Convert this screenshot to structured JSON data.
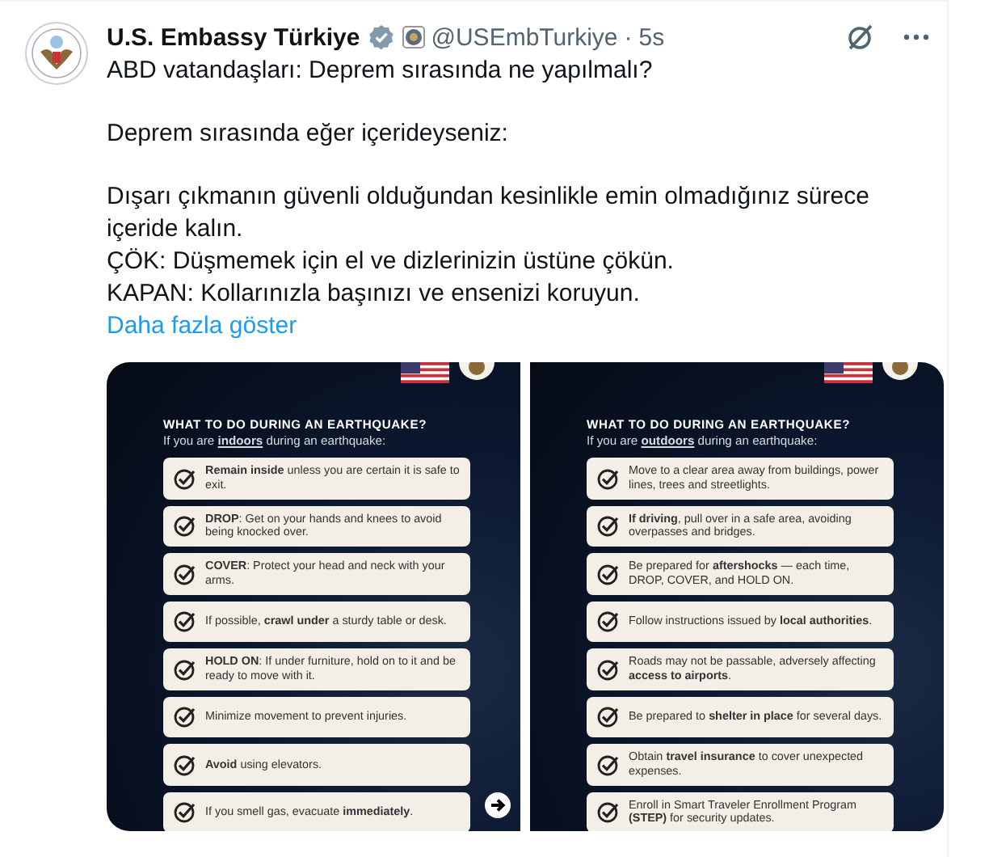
{
  "tweet": {
    "author": "U.S. Embassy Türkiye",
    "handle": "@USEmbTurkiye",
    "separator": "·",
    "time": "5s",
    "paragraphs": [
      [
        "ABD vatandaşları: Deprem sırasında ne yapılmalı?"
      ],
      [
        "Deprem sırasında eğer içerideyseniz:"
      ],
      [
        "Dışarı çıkmanın güvenli olduğundan kesinlikle emin olmadığınız sürece içeride kalın.",
        "ÇÖK: Düşmemek için el ve dizlerinizin üstüne çökün.",
        "KAPAN: Kollarınızla başınızı ve ensenizi koruyun."
      ]
    ],
    "show_more": "Daha fazla göster",
    "images": [
      {
        "heading": "WHAT TO DO DURING AN EARTHQUAKE?",
        "subtitle": "If you are **indoors** during an earthquake:",
        "next_arrow": true,
        "items": [
          "**Remain inside** unless you are certain it is safe to exit.",
          "**DROP**: Get on your hands and knees to avoid being knocked over.",
          "**COVER**: Protect your head and neck with your arms.",
          "If possible, **crawl under** a sturdy table or desk.",
          "**HOLD ON**: If under furniture, hold on to it and be ready to move with it.",
          "Minimize movement to prevent injuries.",
          "**Avoid** using elevators.",
          "If you smell gas, evacuate **immediately**."
        ]
      },
      {
        "heading": "WHAT TO DO DURING AN EARTHQUAKE?",
        "subtitle": "If you are **outdoors** during an earthquake:",
        "next_arrow": false,
        "items": [
          "Move to a clear area away from buildings, power lines, trees and streetlights.",
          "**If driving**, pull over in a safe area, avoiding overpasses and bridges.",
          "Be prepared for **aftershocks** — each time, DROP, COVER, and HOLD ON.",
          "Follow instructions issued by **local authorities**.",
          "Roads may not be passable, adversely affecting **access to airports**.",
          "Be prepared to **shelter in place** for several days.",
          "Obtain **travel insurance** to cover unexpected expenses.",
          "Enroll in Smart Traveler Enrollment Program **(STEP)** for security updates."
        ]
      }
    ]
  }
}
